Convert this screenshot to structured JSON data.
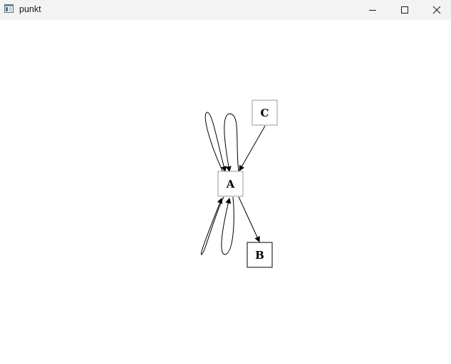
{
  "window": {
    "title": "punkt",
    "icon": "app-window-icon"
  },
  "controls": {
    "minimize_icon": "minimize-icon",
    "maximize_icon": "maximize-icon",
    "close_icon": "close-icon"
  },
  "graph": {
    "nodes": [
      {
        "id": "A",
        "label": "A"
      },
      {
        "id": "B",
        "label": "B"
      },
      {
        "id": "C",
        "label": "C"
      }
    ],
    "edges": [
      {
        "from": "A",
        "to": "B"
      },
      {
        "from": "C",
        "to": "A"
      },
      {
        "from": "A",
        "to": "A",
        "kind": "self-loop"
      },
      {
        "from": "A",
        "to": "A",
        "kind": "self-loop"
      },
      {
        "from": "A",
        "to": "A",
        "kind": "self-loop"
      },
      {
        "from": "A",
        "to": "A",
        "kind": "self-loop"
      }
    ]
  }
}
